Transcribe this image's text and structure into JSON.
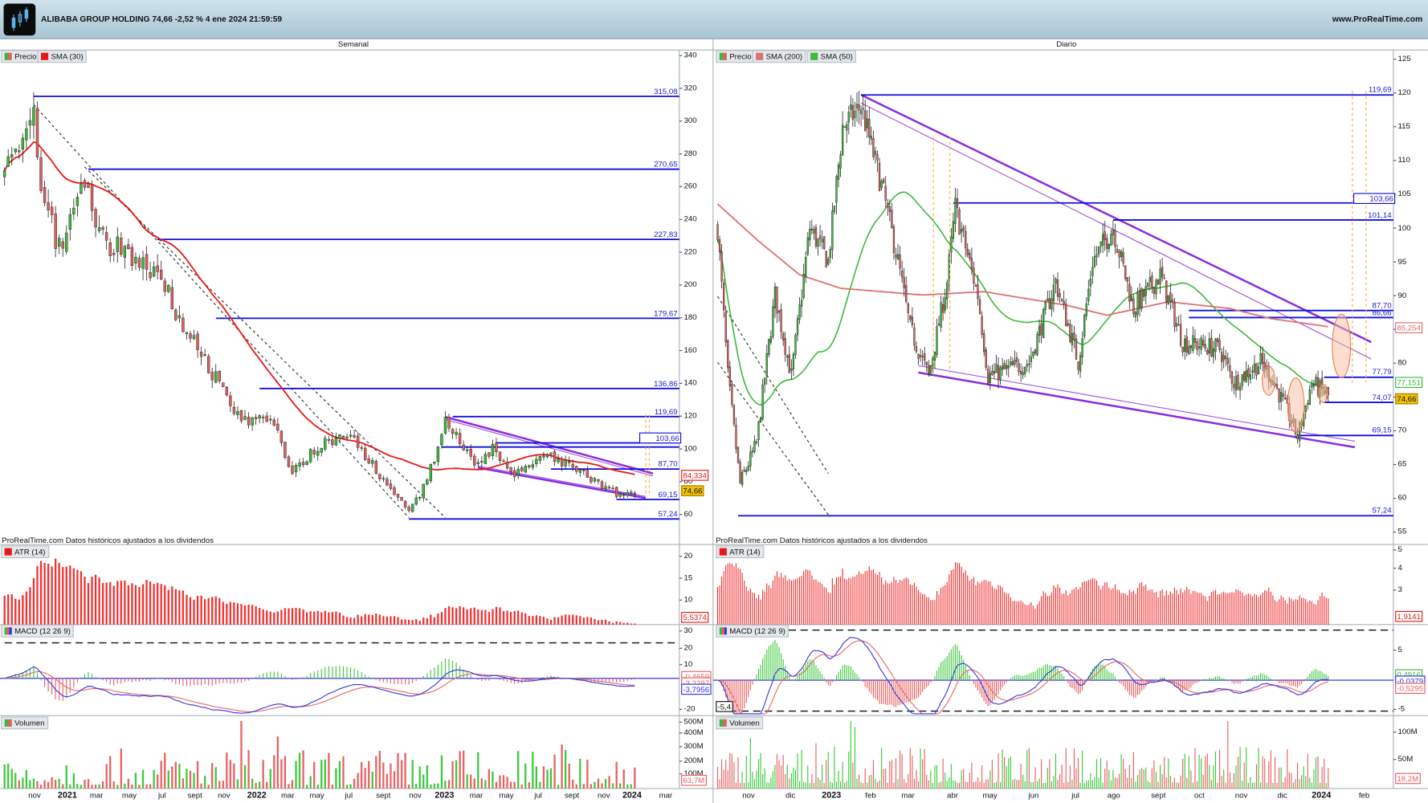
{
  "header": {
    "title": "ALIBABA GROUP HOLDING 74,66 -2,52 % 4 ene 2024 21:59:59",
    "site": "www.ProRealTime.com"
  },
  "colors": {
    "up": "#3cb93c",
    "down": "#e06060",
    "level": "#1010e0",
    "sma30": "#e81818",
    "sma200": "#e07070",
    "sma50": "#3cb83c",
    "trend": "#8a2be2",
    "price_box": "#f2c200"
  },
  "left": {
    "title": "Semanal",
    "legend": [
      "Precio",
      "SMA (30)"
    ],
    "note": "ProRealTime.com Datos históricos ajustados a los dividendos",
    "atr_label": "ATR (14)",
    "macd_label": "MACD (12 26 9)",
    "vol_label": "Volumen",
    "price_ticks": [
      "340",
      "320",
      "300",
      "280",
      "260",
      "240",
      "220",
      "200",
      "180",
      "160",
      "140",
      "120",
      "100",
      "80",
      "60"
    ],
    "levels": [
      {
        "v": 315.08,
        "label": "315,08",
        "from": 8
      },
      {
        "v": 270.65,
        "label": "270,65",
        "from": 23
      },
      {
        "v": 227.83,
        "label": "227,83",
        "from": 42
      },
      {
        "v": 179.67,
        "label": "179,67",
        "from": 58
      },
      {
        "v": 136.86,
        "label": "136,86",
        "from": 70
      },
      {
        "v": 119.69,
        "label": "119,69",
        "from": 123
      },
      {
        "v": 103.66,
        "label": "103,66",
        "from": 135,
        "boxed": true
      },
      {
        "v": 101.14,
        "label": "",
        "from": 120
      },
      {
        "v": 87.7,
        "label": "87,70",
        "from": 150
      },
      {
        "v": 69.15,
        "label": "69,15",
        "from": 168
      },
      {
        "v": 57.24,
        "label": "57,24",
        "from": 111
      }
    ],
    "sma_value": "84,334",
    "last_price": "74,66",
    "atr_ticks": [
      "20",
      "15",
      "10"
    ],
    "atr_value": "5,5374",
    "macd_ticks": [
      "30",
      "20",
      "10",
      "-20"
    ],
    "macd_values": [
      "-0,4659",
      "-3,2297",
      "-3,7956"
    ],
    "vol_ticks": [
      "500M",
      "400M",
      "300M",
      "200M",
      "100M"
    ],
    "vol_value": "63,7M",
    "x_labels": [
      {
        "t": "nov"
      },
      {
        "t": "2021",
        "b": true
      },
      {
        "t": "mar"
      },
      {
        "t": "may"
      },
      {
        "t": "jul"
      },
      {
        "t": "sept"
      },
      {
        "t": "nov"
      },
      {
        "t": "2022",
        "b": true
      },
      {
        "t": "mar"
      },
      {
        "t": "may"
      },
      {
        "t": "jul"
      },
      {
        "t": "sept"
      },
      {
        "t": "nov"
      },
      {
        "t": "2023",
        "b": true
      },
      {
        "t": "mar"
      },
      {
        "t": "may"
      },
      {
        "t": "jul"
      },
      {
        "t": "sept"
      },
      {
        "t": "nov"
      },
      {
        "t": "2024",
        "b": true
      },
      {
        "t": "mar"
      }
    ],
    "price_path": [
      [
        0,
        265
      ],
      [
        4,
        290
      ],
      [
        8,
        310
      ],
      [
        10,
        250
      ],
      [
        16,
        220
      ],
      [
        22,
        265
      ],
      [
        26,
        230
      ],
      [
        36,
        215
      ],
      [
        44,
        200
      ],
      [
        49,
        175
      ],
      [
        56,
        150
      ],
      [
        64,
        120
      ],
      [
        74,
        115
      ],
      [
        79,
        85
      ],
      [
        85,
        100
      ],
      [
        95,
        110
      ],
      [
        101,
        90
      ],
      [
        111,
        62
      ],
      [
        116,
        80
      ],
      [
        121,
        118
      ],
      [
        129,
        90
      ],
      [
        134,
        100
      ],
      [
        139,
        85
      ],
      [
        150,
        95
      ],
      [
        159,
        85
      ],
      [
        169,
        72
      ],
      [
        173,
        75
      ]
    ],
    "trendlines": [
      {
        "a": [
          8,
          310
        ],
        "b": [
          111,
          58
        ],
        "style": "dash"
      },
      {
        "a": [
          22,
          272
        ],
        "b": [
          121,
          58
        ],
        "style": "dash"
      },
      {
        "a": [
          121,
          119.5
        ],
        "b": [
          178,
          85
        ],
        "style": "purple"
      },
      {
        "a": [
          121,
          118
        ],
        "b": [
          178,
          83.5
        ],
        "style": "thin"
      },
      {
        "a": [
          130,
          88.5
        ],
        "b": [
          176,
          70
        ],
        "style": "purple"
      },
      {
        "a": [
          130,
          89.5
        ],
        "b": [
          176,
          71
        ],
        "style": "thin"
      }
    ]
  },
  "right": {
    "title": "Diario",
    "legend": [
      "Precio",
      "SMA (200)",
      "SMA (50)"
    ],
    "note": "ProRealTime.com Datos históricos ajustados a los dividendos",
    "atr_label": "ATR (14)",
    "macd_label": "MACD (12 26 9)",
    "vol_label": "Volumen",
    "price_ticks": [
      "125",
      "120",
      "115",
      "110",
      "105",
      "100",
      "95",
      "90",
      "85",
      "80",
      "75",
      "70",
      "65",
      "60",
      "55"
    ],
    "levels": [
      {
        "v": 119.69,
        "label": "119,69",
        "from": 70
      },
      {
        "v": 103.66,
        "label": "103,66",
        "from": 115,
        "boxed": true
      },
      {
        "v": 101.14,
        "label": "101,14",
        "from": 193
      },
      {
        "v": 87.7,
        "label": "87,70",
        "from": 230
      },
      {
        "v": 86.66,
        "label": "86,66",
        "from": 230
      },
      {
        "v": 77.79,
        "label": "77,79",
        "from": 296
      },
      {
        "v": 74.07,
        "label": "74,07",
        "from": 296
      },
      {
        "v": 69.15,
        "label": "69,15",
        "from": 283
      },
      {
        "v": 57.24,
        "label": "57,24",
        "from": 10
      }
    ],
    "sma200_value": "85,254",
    "sma50_value": "77,151",
    "last_price": "74,66",
    "atr_ticks": [
      "5",
      "4",
      "3"
    ],
    "atr_value": "1,9141",
    "macd_ticks": [
      "5",
      "-5"
    ],
    "macd_values": [
      "0,4916",
      "-0,0379",
      "-0,5295"
    ],
    "macd_min_box": "-5,4",
    "vol_ticks": [
      "100M",
      "50M"
    ],
    "vol_value": "18,2M",
    "x_labels": [
      {
        "t": "nov"
      },
      {
        "t": "dic"
      },
      {
        "t": "2023",
        "b": true
      },
      {
        "t": "feb"
      },
      {
        "t": "mar"
      },
      {
        "t": "abr"
      },
      {
        "t": "may"
      },
      {
        "t": "jun"
      },
      {
        "t": "jul"
      },
      {
        "t": "ago"
      },
      {
        "t": "sept"
      },
      {
        "t": "oct"
      },
      {
        "t": "nov"
      },
      {
        "t": "dic"
      },
      {
        "t": "2024",
        "b": true
      },
      {
        "t": "feb"
      }
    ],
    "price_path": [
      [
        0,
        100
      ],
      [
        5,
        78
      ],
      [
        11,
        62
      ],
      [
        19,
        68
      ],
      [
        28,
        90
      ],
      [
        36,
        78
      ],
      [
        45,
        100
      ],
      [
        54,
        95
      ],
      [
        61,
        115
      ],
      [
        70,
        118
      ],
      [
        81,
        105
      ],
      [
        88,
        95
      ],
      [
        94,
        85
      ],
      [
        103,
        78
      ],
      [
        112,
        92
      ],
      [
        116,
        103
      ],
      [
        127,
        90
      ],
      [
        132,
        78
      ],
      [
        152,
        80
      ],
      [
        165,
        92
      ],
      [
        176,
        80
      ],
      [
        183,
        95
      ],
      [
        193,
        100
      ],
      [
        203,
        88
      ],
      [
        216,
        93
      ],
      [
        227,
        83
      ],
      [
        245,
        82
      ],
      [
        252,
        77
      ],
      [
        265,
        80
      ],
      [
        270,
        78
      ],
      [
        279,
        72
      ],
      [
        283,
        69
      ],
      [
        290,
        77
      ],
      [
        298,
        75
      ]
    ],
    "sma200_path": [
      [
        0,
        103.5
      ],
      [
        20,
        98
      ],
      [
        40,
        93
      ],
      [
        60,
        91
      ],
      [
        100,
        90
      ],
      [
        130,
        90.5
      ],
      [
        170,
        88.5
      ],
      [
        190,
        87
      ],
      [
        220,
        89
      ],
      [
        250,
        88
      ],
      [
        270,
        86.5
      ],
      [
        298,
        85.3
      ]
    ],
    "trendlines": [
      {
        "a": [
          0,
          89.8
        ],
        "b": [
          54,
          63.5
        ],
        "style": "dash"
      },
      {
        "a": [
          0,
          80
        ],
        "b": [
          55,
          57
        ],
        "style": "dash"
      },
      {
        "a": [
          70,
          119.7
        ],
        "b": [
          319,
          83
        ],
        "style": "purple"
      },
      {
        "a": [
          70,
          118.5
        ],
        "b": [
          319,
          80.5
        ],
        "style": "thin"
      },
      {
        "a": [
          98,
          78.5
        ],
        "b": [
          311,
          67.4
        ],
        "style": "purple"
      },
      {
        "a": [
          98,
          79.5
        ],
        "b": [
          311,
          68.3
        ],
        "style": "thin"
      }
    ]
  }
}
